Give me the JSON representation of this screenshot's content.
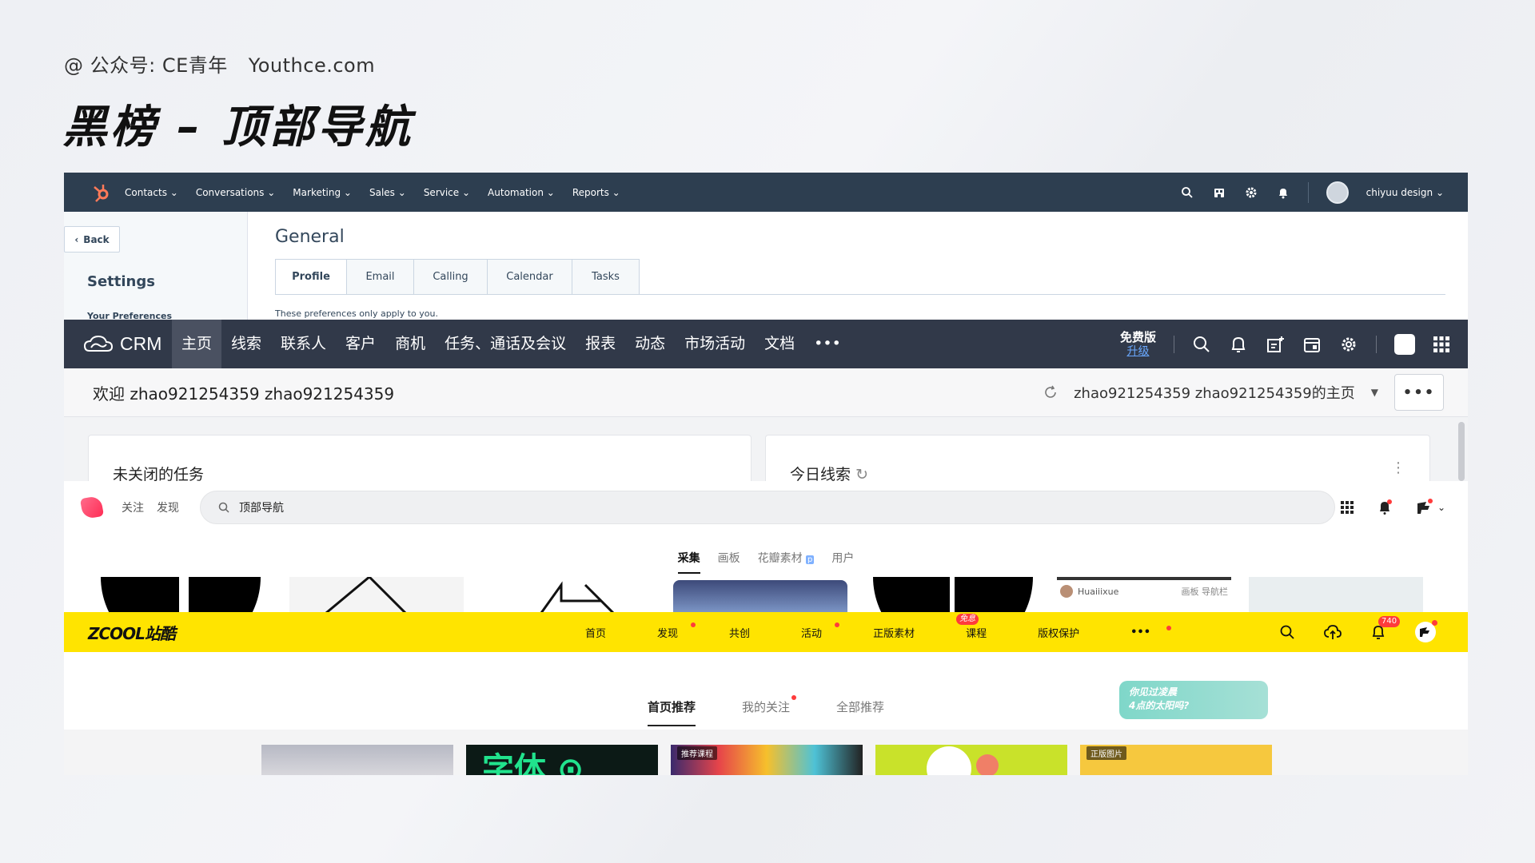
{
  "page": {
    "attribution": "@ 公众号: CE青年",
    "site": "Youthce.com",
    "title": "黑榜 – 顶部导航"
  },
  "hubspot": {
    "nav": [
      "Contacts",
      "Conversations",
      "Marketing",
      "Sales",
      "Service",
      "Automation",
      "Reports"
    ],
    "user": "chiyuu design",
    "back_label": "Back",
    "settings_title": "Settings",
    "pref_label": "Your Preferences",
    "section_title": "General",
    "tabs": [
      "Profile",
      "Email",
      "Calling",
      "Calendar",
      "Tasks"
    ],
    "note": "These preferences only apply to you.",
    "colors": {
      "bar": "#2d3e50",
      "accent": "#ff7a59"
    }
  },
  "crm": {
    "logo_text": "CRM",
    "nav": [
      "主页",
      "线索",
      "联系人",
      "客户",
      "商机",
      "任务、通话及会议",
      "报表",
      "动态",
      "市场活动",
      "文档"
    ],
    "more_label": "•••",
    "plan": "免费版",
    "upgrade": "升级",
    "welcome": "欢迎 zhao921254359 zhao921254359",
    "home_select": "zhao921254359 zhao921254359的主页",
    "more_button": "•••",
    "cards": [
      "未关闭的任务",
      "今日线索"
    ],
    "colors": {
      "bar": "#313949"
    }
  },
  "huaban": {
    "links": [
      "关注",
      "发现"
    ],
    "search_value": "顶部导航",
    "tabs": [
      "采集",
      "画板",
      "花瓣素材",
      "用户"
    ],
    "pin_user": "Huaiiixue",
    "pin_meta": "画板 导航栏"
  },
  "zcool": {
    "logo": "ZCOOL站酷",
    "nav": [
      "首页",
      "发现",
      "共创",
      "活动",
      "正版素材",
      "课程",
      "版权保护",
      "•••"
    ],
    "course_badge": "免息",
    "notif_count": "740",
    "tabs": [
      "首页推荐",
      "我的关注",
      "全部推荐"
    ],
    "ad_text_1": "你见过凌晨",
    "ad_text_2": "4点的太阳吗?",
    "thumb_tags": [
      "推荐课程",
      "正版图片"
    ],
    "colors": {
      "bar": "#ffe400"
    }
  }
}
